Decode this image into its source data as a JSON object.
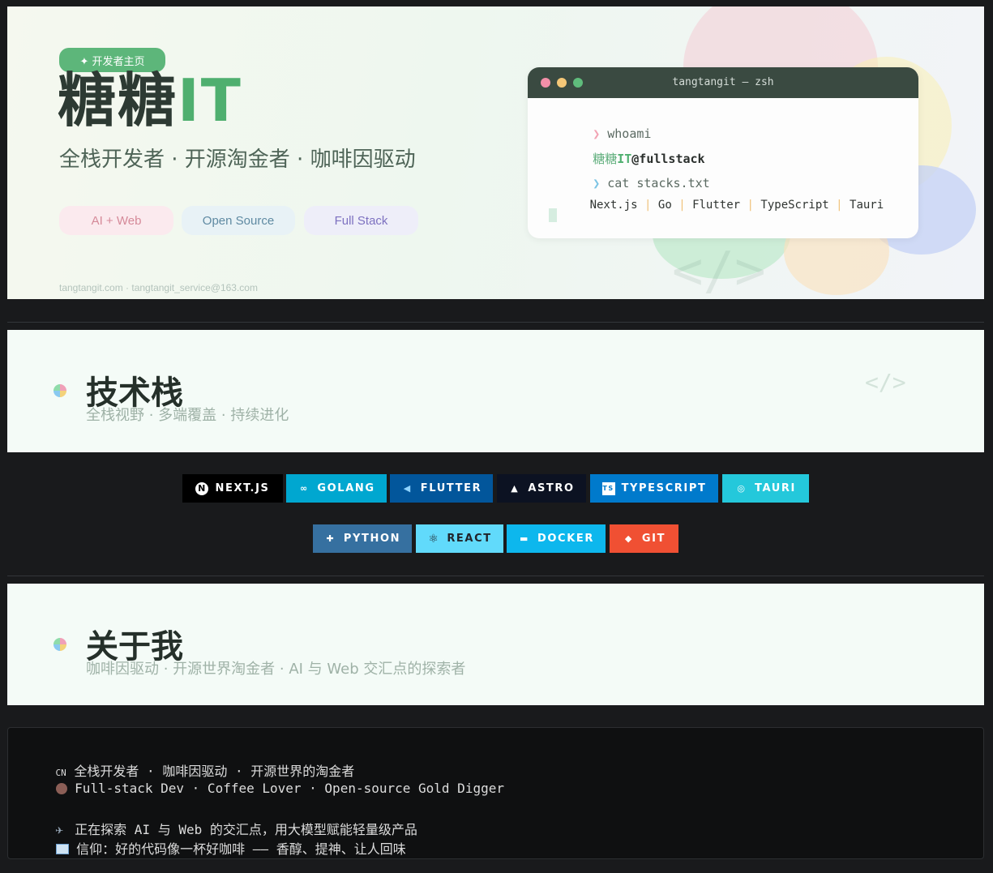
{
  "hero": {
    "badge": "✦ 开发者主页",
    "title_main": "糖糖",
    "title_accent": "IT",
    "subtitle": "全栈开发者 · 开源淘金者 · 咖啡因驱动",
    "pills": [
      "AI + Web",
      "Open Source",
      "Full Stack"
    ],
    "footer": "tangtangit.com · tangtangit_service@163.com",
    "deco_code_icon": "</>"
  },
  "terminal": {
    "title": "tangtangit — zsh",
    "prompt_symbol": "❯",
    "cmd1": "whoami",
    "out1_prefix": "糖糖",
    "out1_accent": "IT",
    "out1_rest": "@fullstack",
    "cmd2": "cat stacks.txt",
    "stacks": [
      "Next.js",
      "Go",
      "Flutter",
      "TypeScript",
      "Tauri"
    ],
    "separator": "|"
  },
  "tech_section": {
    "title": "技术栈",
    "subtitle": "全栈视野 · 多端覆盖 · 持续进化",
    "deco_icon": "</>"
  },
  "badges_row1": [
    {
      "label": "NEXT.JS",
      "icon": "nextjs-icon",
      "glyph": "N",
      "bg": "#000000"
    },
    {
      "label": "GOLANG",
      "icon": "go-icon",
      "glyph": "∞",
      "bg": "#00a7d0"
    },
    {
      "label": "FLUTTER",
      "icon": "flutter-icon",
      "glyph": "◀",
      "bg": "#02569b"
    },
    {
      "label": "ASTRO",
      "icon": "astro-icon",
      "glyph": "▲",
      "bg": "#0c1222"
    },
    {
      "label": "TYPESCRIPT",
      "icon": "typescript-icon",
      "glyph": "TS",
      "bg": "#007acc"
    },
    {
      "label": "TAURI",
      "icon": "tauri-icon",
      "glyph": "◎",
      "bg": "#24c8db"
    }
  ],
  "badges_row2": [
    {
      "label": "PYTHON",
      "icon": "python-icon",
      "glyph": "✚",
      "bg": "#3670a0"
    },
    {
      "label": "REACT",
      "icon": "react-icon",
      "glyph": "⚛",
      "bg": "#61dafb"
    },
    {
      "label": "DOCKER",
      "icon": "docker-icon",
      "glyph": "▬",
      "bg": "#0db7ed"
    },
    {
      "label": "GIT",
      "icon": "git-icon",
      "glyph": "◆",
      "bg": "#f05033"
    }
  ],
  "about_section": {
    "title": "关于我",
    "subtitle": "咖啡因驱动 · 开源世界淘金者 · AI 与 Web 交汇点的探索者"
  },
  "about_text": {
    "line1_icon": "CN",
    "line1": "全栈开发者 · 咖啡因驱动 · 开源世界的淘金者",
    "line2_icon": "🧋",
    "line2": "Full-stack Dev · Coffee Lover · Open-source Gold Digger",
    "line3_icon": "🔭",
    "line3": "正在探索 AI 与 Web 的交汇点，用大模型赋能轻量级产品",
    "line4_icon": "📖",
    "line4": "信仰：好的代码像一杯好咖啡 —— 香醇、提神、让人回味"
  },
  "colors": {
    "accent_green": "#4faf6f",
    "page_bg": "#191a1c",
    "card_bg": "#f4fbf7"
  }
}
